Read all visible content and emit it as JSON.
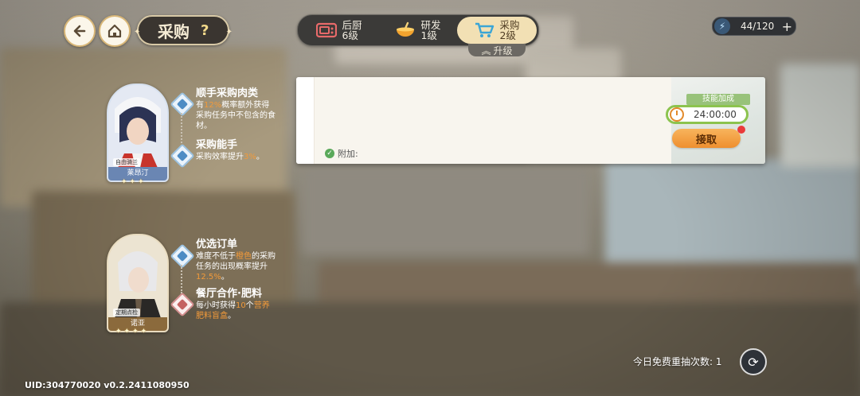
{
  "header": {
    "title": "采购",
    "help": "?",
    "tabs": [
      {
        "label": "后厨",
        "level": "6级",
        "icon": "microwave-icon",
        "active": false
      },
      {
        "label": "研发",
        "level": "1级",
        "icon": "mixing-bowl-icon",
        "active": false
      },
      {
        "label": "采购",
        "level": "2级",
        "icon": "shopping-cart-icon",
        "active": true
      }
    ],
    "upgrade_label": "升级",
    "energy": "44/120"
  },
  "characters": [
    {
      "name": "莱昂汀",
      "tag": "自由骑兰",
      "skills": [
        {
          "title": "顺手采购肉类",
          "desc": [
            "有",
            "12%",
            "概率额外获得采购任务中不包含的食材。"
          ]
        },
        {
          "title": "采购能手",
          "desc": [
            "采购效率提升",
            "3%",
            "。"
          ]
        }
      ]
    },
    {
      "name": "诺亚",
      "tag": "定期点检",
      "skills": [
        {
          "title": "优选订单",
          "desc": [
            "难度不低于",
            "橙色",
            "的采购任务的出现概率提升",
            "12.5%",
            "。"
          ]
        },
        {
          "title": "餐厅合作·肥料",
          "desc": [
            "每小时获得",
            "10",
            "个",
            "营养肥料盲盒",
            "。"
          ]
        }
      ]
    }
  ],
  "order": {
    "attach_label": "附加:",
    "skill_bonus": "技能加成",
    "timer": "24:00:00",
    "accept": "接取"
  },
  "footer": {
    "reroll_label": "今日免费重抽次数:",
    "reroll_count": "1",
    "uid": "UID:304770020  v0.2.2411080950"
  },
  "colors": {
    "accent_orange": "#f29a3a",
    "active_tab": "#f2e0b4",
    "timer_green": "#8cc34e"
  }
}
